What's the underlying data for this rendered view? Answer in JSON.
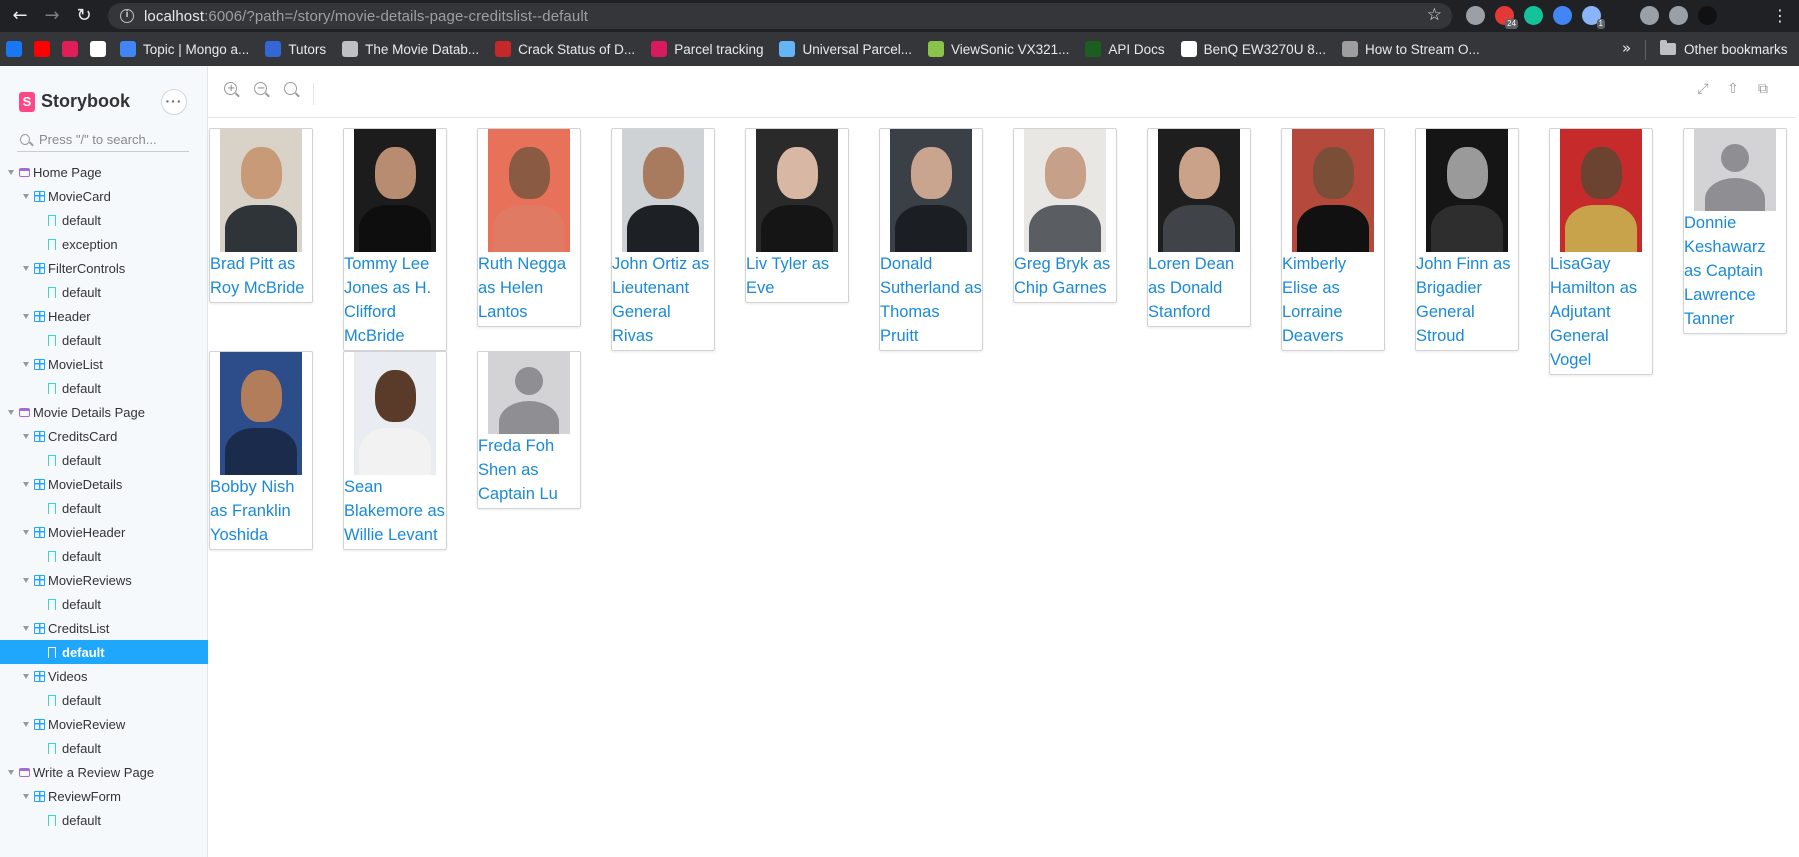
{
  "browser": {
    "url_host": "localhost",
    "url_rest": ":6006/?path=/story/movie-details-page-creditslist--default",
    "bookmarks": [
      {
        "label": "",
        "icon": "facebook-icon",
        "color": "#1877f2"
      },
      {
        "label": "",
        "icon": "youtube-icon",
        "color": "#ff0000"
      },
      {
        "label": "",
        "icon": "slack-icon",
        "color": "#e01e5a"
      },
      {
        "label": "",
        "icon": "amazon-icon",
        "color": "#ffffff"
      },
      {
        "label": "Topic | Mongo a...",
        "icon": "mongo-icon",
        "color": "#4285f4"
      },
      {
        "label": "Tutors",
        "icon": "tutors-icon",
        "color": "#3367d6"
      },
      {
        "label": "The Movie Datab...",
        "icon": "globe-icon",
        "color": "#bdc1c6"
      },
      {
        "label": "Crack Status of D...",
        "icon": "crack-icon",
        "color": "#c62828"
      },
      {
        "label": "Parcel tracking",
        "icon": "parcel-icon",
        "color": "#d81b60"
      },
      {
        "label": "Universal Parcel...",
        "icon": "universal-parcel-icon",
        "color": "#64b5f6"
      },
      {
        "label": "ViewSonic VX321...",
        "icon": "viewsonic-icon",
        "color": "#8bc34a"
      },
      {
        "label": "API Docs",
        "icon": "api-docs-icon",
        "color": "#1b5e20"
      },
      {
        "label": "BenQ EW3270U 8...",
        "icon": "amazon-icon",
        "color": "#ffffff"
      },
      {
        "label": "How to Stream O...",
        "icon": "stream-icon",
        "color": "#9e9e9e"
      }
    ],
    "other_bookmarks": "Other bookmarks",
    "extensions": [
      {
        "icon": "ext-gray-icon",
        "color": "#9aa0a6",
        "badge": ""
      },
      {
        "icon": "apd-icon",
        "color": "#e53935",
        "badge": "24"
      },
      {
        "icon": "grammarly-icon",
        "color": "#15c39a",
        "badge": ""
      },
      {
        "icon": "feather-icon",
        "color": "#4285f4",
        "badge": ""
      },
      {
        "icon": "puzzle-icon",
        "color": "#8ab4f8",
        "badge": "1"
      },
      {
        "icon": "moon-icon",
        "color": "#202124",
        "badge": ""
      },
      {
        "icon": "profile-mask-icon",
        "color": "#9aa0a6",
        "badge": ""
      },
      {
        "icon": "speed-icon",
        "color": "#9aa0a6",
        "badge": ""
      },
      {
        "icon": "account-icon",
        "color": "#111111",
        "badge": ""
      }
    ]
  },
  "storybook": {
    "brand": "Storybook",
    "search_placeholder": "Press \"/\" to search...",
    "tree": [
      {
        "kind": "group",
        "label": "Home Page",
        "level": 0,
        "selected": false
      },
      {
        "kind": "component",
        "label": "MovieCard",
        "level": 1,
        "selected": false
      },
      {
        "kind": "story",
        "label": "default",
        "level": 2,
        "selected": false
      },
      {
        "kind": "story",
        "label": "exception",
        "level": 2,
        "selected": false
      },
      {
        "kind": "component",
        "label": "FilterControls",
        "level": 1,
        "selected": false
      },
      {
        "kind": "story",
        "label": "default",
        "level": 2,
        "selected": false
      },
      {
        "kind": "component",
        "label": "Header",
        "level": 1,
        "selected": false
      },
      {
        "kind": "story",
        "label": "default",
        "level": 2,
        "selected": false
      },
      {
        "kind": "component",
        "label": "MovieList",
        "level": 1,
        "selected": false
      },
      {
        "kind": "story",
        "label": "default",
        "level": 2,
        "selected": false
      },
      {
        "kind": "group",
        "label": "Movie Details Page",
        "level": 0,
        "selected": false
      },
      {
        "kind": "component",
        "label": "CreditsCard",
        "level": 1,
        "selected": false
      },
      {
        "kind": "story",
        "label": "default",
        "level": 2,
        "selected": false
      },
      {
        "kind": "component",
        "label": "MovieDetails",
        "level": 1,
        "selected": false
      },
      {
        "kind": "story",
        "label": "default",
        "level": 2,
        "selected": false
      },
      {
        "kind": "component",
        "label": "MovieHeader",
        "level": 1,
        "selected": false
      },
      {
        "kind": "story",
        "label": "default",
        "level": 2,
        "selected": false
      },
      {
        "kind": "component",
        "label": "MovieReviews",
        "level": 1,
        "selected": false
      },
      {
        "kind": "story",
        "label": "default",
        "level": 2,
        "selected": false
      },
      {
        "kind": "component",
        "label": "CreditsList",
        "level": 1,
        "selected": false
      },
      {
        "kind": "story",
        "label": "default",
        "level": 2,
        "selected": true
      },
      {
        "kind": "component",
        "label": "Videos",
        "level": 1,
        "selected": false
      },
      {
        "kind": "story",
        "label": "default",
        "level": 2,
        "selected": false
      },
      {
        "kind": "component",
        "label": "MovieReview",
        "level": 1,
        "selected": false
      },
      {
        "kind": "story",
        "label": "default",
        "level": 2,
        "selected": false
      },
      {
        "kind": "group",
        "label": "Write a Review Page",
        "level": 0,
        "selected": false
      },
      {
        "kind": "component",
        "label": "ReviewForm",
        "level": 1,
        "selected": false
      },
      {
        "kind": "story",
        "label": "default",
        "level": 2,
        "selected": false
      }
    ]
  },
  "credits": [
    {
      "text": "Brad Pitt as Roy McBride",
      "photo": true,
      "bg": "#d9d2c8",
      "skin": "#c99a78",
      "cloth": "#2f3438"
    },
    {
      "text": "Tommy Lee Jones as H. Clifford McBride",
      "photo": true,
      "bg": "#1c1c1c",
      "skin": "#b88c70",
      "cloth": "#0e0e0e"
    },
    {
      "text": "Ruth Negga as Helen Lantos",
      "photo": true,
      "bg": "#e8715a",
      "skin": "#8a5a42",
      "cloth": "#e07a62"
    },
    {
      "text": "John Ortiz as Lieutenant General Rivas",
      "photo": true,
      "bg": "#cfd2d4",
      "skin": "#a87a5e",
      "cloth": "#1d2126"
    },
    {
      "text": "Liv Tyler as Eve",
      "photo": true,
      "bg": "#2a2a2a",
      "skin": "#d8b8a4",
      "cloth": "#151515"
    },
    {
      "text": "Donald Sutherland as Thomas Pruitt",
      "photo": true,
      "bg": "#3a4046",
      "skin": "#c9a590",
      "cloth": "#1b1f24"
    },
    {
      "text": "Greg Bryk as Chip Garnes",
      "photo": true,
      "bg": "#e9e7e4",
      "skin": "#c6a089",
      "cloth": "#5a5e63"
    },
    {
      "text": "Loren Dean as Donald Stanford",
      "photo": true,
      "bg": "#1e1e1e",
      "skin": "#caa28a",
      "cloth": "#404448"
    },
    {
      "text": "Kimberly Elise as Lorraine Deavers",
      "photo": true,
      "bg": "#b54a3c",
      "skin": "#7b4e38",
      "cloth": "#111111"
    },
    {
      "text": "John Finn as Brigadier General Stroud",
      "photo": true,
      "bg": "#151515",
      "skin": "#9a9a9a",
      "cloth": "#2e2e2e"
    },
    {
      "text": "LisaGay Hamilton as Adjutant General Vogel",
      "photo": true,
      "bg": "#c62a2a",
      "skin": "#6b4330",
      "cloth": "#c9a24c"
    },
    {
      "text": "Donnie Keshawarz as Captain Lawrence Tanner",
      "photo": false
    },
    {
      "text": "Bobby Nish as Franklin Yoshida",
      "photo": true,
      "bg": "#2c4d8a",
      "skin": "#b27d5b",
      "cloth": "#1b2b4c"
    },
    {
      "text": "Sean Blakemore as Willie Levant",
      "photo": true,
      "bg": "#e9edf2",
      "skin": "#5a3a28",
      "cloth": "#f2f2f2"
    },
    {
      "text": "Freda Foh Shen as Captain Lu",
      "photo": false
    }
  ]
}
